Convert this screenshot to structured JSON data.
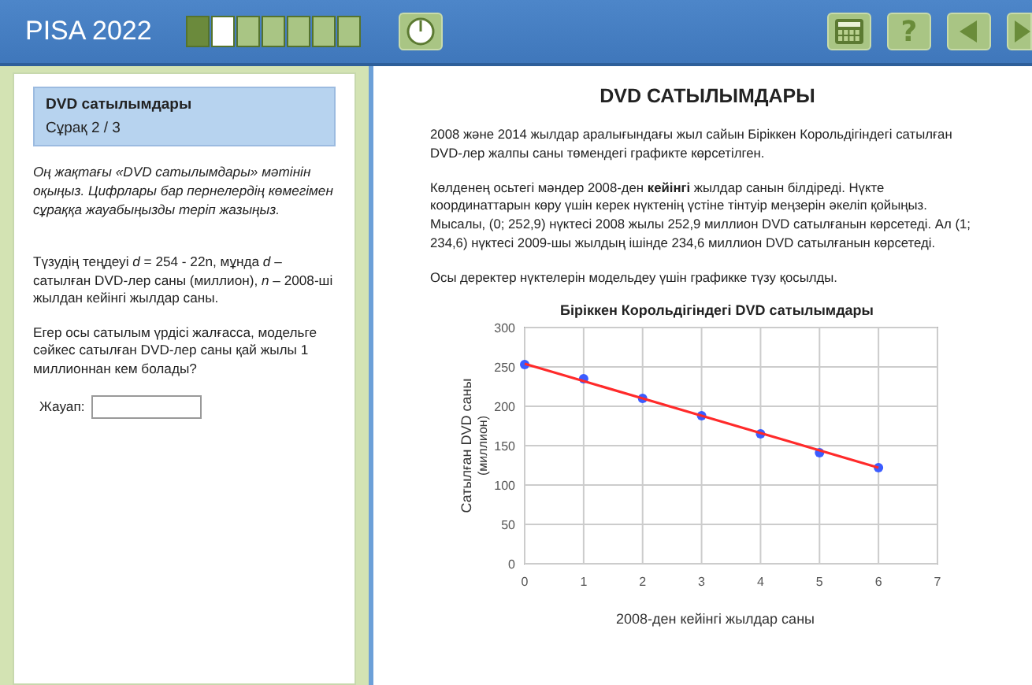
{
  "header": {
    "title": "PISA 2022",
    "progress": [
      {
        "done": true,
        "selected": false
      },
      {
        "done": false,
        "selected": true
      },
      {
        "done": false,
        "selected": false
      },
      {
        "done": false,
        "selected": false
      },
      {
        "done": false,
        "selected": false
      },
      {
        "done": false,
        "selected": false
      },
      {
        "done": false,
        "selected": false
      }
    ],
    "help_label": "?"
  },
  "question": {
    "unit": "DVD сатылымдары",
    "counter": "Сұрақ 2 / 3",
    "instruction": "Оң жақтағы «DVD сатылымдары» мәтінін оқыңыз. Цифрлары бар пернелердің көмегімен сұраққа жауабыңызды теріп жазыңыз.",
    "paragraphs": [
      "Түзудің теңдеуі *d* = 254 - 22n, мұнда *d* – сатылған DVD-лер саны (миллион), *n* – 2008-ші жылдан кейінгі жылдар саны.",
      "Егер осы сатылым үрдісі жалғасса, модельге сәйкес сатылған DVD-лер саны қай жылы 1 миллионнан кем болады?"
    ],
    "answer_label": "Жауап:"
  },
  "stimulus": {
    "title": "DVD САТЫЛЫМДАРЫ",
    "paragraphs": [
      "2008 және 2014 жылдар аралығындағы жыл сайын Біріккен Корольдігіндегі сатылған DVD-лер жалпы саны төмендегі графикте көрсетілген.",
      "Көлденең осьтегі мәндер 2008-ден **кейінгі** жылдар санын білдіреді. Нүкте координаттарын көру үшін керек нүктенің үстіне тінтуір меңзерін әкеліп қойыңыз. Мысалы, (0; 252,9) нүктесі 2008 жылы 252,9 миллион DVD сатылғанын көрсетеді. Ал (1; 234,6) нүктесі 2009-шы жылдың ішінде 234,6 миллион DVD сатылғанын көрсетеді.",
      "Осы деректер нүктелерін модельдеу үшін графикке түзу қосылды."
    ],
    "chart_data": {
      "type": "scatter",
      "title": "Біріккен Корольдігіндегі DVD сатылымдары",
      "xlabel": "2008-ден кейінгі жылдар саны",
      "ylabel": "Сатылған DVD саны (миллион)",
      "x": [
        0,
        1,
        2,
        3,
        4,
        5,
        6
      ],
      "series": [
        {
          "color": "#3b5cff",
          "values": [
            253,
            235,
            210,
            188,
            165,
            141,
            122
          ]
        },
        {
          "type": "line",
          "color": "#ff2a2a",
          "values": [
            254,
            232,
            210,
            188,
            166,
            144,
            122
          ]
        }
      ],
      "grid": true,
      "xlim": [
        0,
        7
      ],
      "ylim": [
        0,
        300
      ],
      "xticks": [
        0,
        1,
        2,
        3,
        4,
        5,
        6,
        7
      ],
      "yticks": [
        0,
        50,
        100,
        150,
        200,
        250,
        300
      ]
    }
  }
}
